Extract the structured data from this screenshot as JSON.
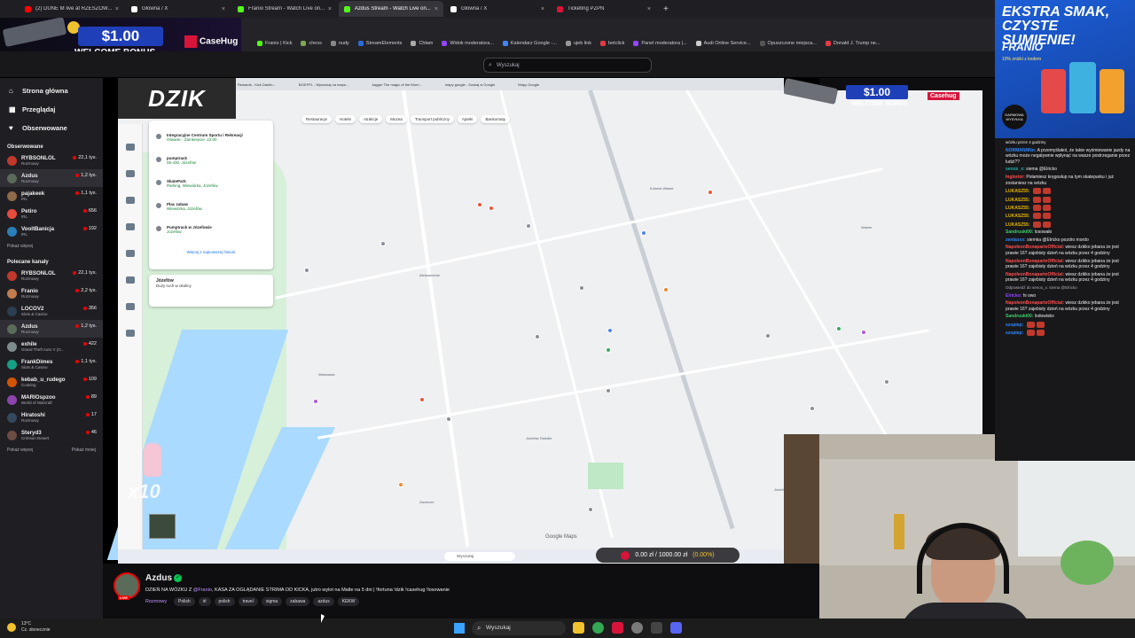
{
  "browser": {
    "tabs": [
      {
        "label": "(2) DUNE M live at RZESZOW...",
        "color": "#ff0000",
        "active": false
      },
      {
        "label": "Główna / X",
        "color": "#ffffff",
        "active": false
      },
      {
        "label": "Franio Stream - Watch Live on...",
        "color": "#53fc18",
        "active": false
      },
      {
        "label": "Azdus Stream - Watch Live on...",
        "color": "#53fc18",
        "active": true
      },
      {
        "label": "Główna / X",
        "color": "#ffffff",
        "active": false
      },
      {
        "label": "Ticketing PZPN",
        "color": "#d8143a",
        "active": false
      }
    ],
    "new_tab": "+",
    "bookmarks": [
      {
        "label": "Franio | Kick",
        "color": "#53fc18"
      },
      {
        "label": "chess",
        "color": "#7fa650"
      },
      {
        "label": "nudy",
        "color": "#888888"
      },
      {
        "label": "StreamElements",
        "color": "#2a6bd8"
      },
      {
        "label": "Chłam",
        "color": "#aaaaaa"
      },
      {
        "label": "Widok moderatora...",
        "color": "#9146ff"
      },
      {
        "label": "Kalendarz Google -...",
        "color": "#4285f4"
      },
      {
        "label": "ujeb link",
        "color": "#999999"
      },
      {
        "label": "betclick",
        "color": "#e63946"
      },
      {
        "label": "Panel moderatora |...",
        "color": "#9146ff"
      },
      {
        "label": "Audi Online Service...",
        "color": "#cccccc"
      },
      {
        "label": "Opuszczone miejsca...",
        "color": "#555555"
      },
      {
        "label": "Donald J. Trump ne...",
        "color": "#e63946"
      }
    ]
  },
  "ads": {
    "top_left": {
      "amount": "$1.00",
      "text": "WELCOME BONUS",
      "brand": "CaseHug"
    },
    "overlay": {
      "amount": "$1.00",
      "text": "WELCOME BONUS",
      "brand": "Casehug"
    },
    "right": {
      "headline": "EKSTRA SMAK, CZYSTE SUMIENIE!",
      "brand": "FRANIO",
      "sub": "10% zniżki z kodem",
      "badge": "DARMOWA WYSYŁKA"
    }
  },
  "twitch": {
    "search_placeholder": "Wyszukaj",
    "nav": [
      {
        "label": "Strona główna",
        "icon": "home-icon"
      },
      {
        "label": "Przeglądaj",
        "icon": "browse-icon"
      },
      {
        "label": "Obserwowane",
        "icon": "heart-icon"
      }
    ],
    "followed_heading": "Obserwowane",
    "followed": [
      {
        "name": "RYBSONLOL",
        "category": "Rozmowy",
        "viewers": "22,1 tys.",
        "color": "#c0392b"
      },
      {
        "name": "Azdus",
        "category": "Rozmowy",
        "viewers": "1,2 tys.",
        "color": "#5b6b5a",
        "selected": true
      },
      {
        "name": "pajakeek",
        "category": "IRL",
        "viewers": "1,1 tys.",
        "color": "#8e6b4a"
      },
      {
        "name": "Petiro",
        "category": "IRL",
        "viewers": "656",
        "color": "#e74c3c"
      },
      {
        "name": "VooltBanicja",
        "category": "IRL",
        "viewers": "192",
        "color": "#2980b9"
      }
    ],
    "show_more": "Pokaż więcej",
    "recommended_heading": "Polecane kanały",
    "recommended": [
      {
        "name": "RYBSONLOL",
        "category": "Rozmowy",
        "viewers": "22,1 tys.",
        "color": "#c0392b"
      },
      {
        "name": "Franio",
        "category": "Rozmowy",
        "viewers": "2,2 tys.",
        "color": "#c27c4e"
      },
      {
        "name": "LOCOV2",
        "category": "Slots & Casino",
        "viewers": "356",
        "color": "#2c3e50"
      },
      {
        "name": "Azdus",
        "category": "Rozmowy",
        "viewers": "1,2 tys.",
        "color": "#5b6b5a",
        "selected": true
      },
      {
        "name": "exhile",
        "category": "Grand Theft Auto V (G...",
        "viewers": "422",
        "color": "#7f8c8d"
      },
      {
        "name": "FrankDimes",
        "category": "Slots & Casino",
        "viewers": "1,1 tys.",
        "color": "#16a085"
      },
      {
        "name": "kebab_u_rudego",
        "category": "Cooking",
        "viewers": "109",
        "color": "#d35400"
      },
      {
        "name": "MARIOspzoo",
        "category": "World of Warcraft",
        "viewers": "89",
        "color": "#8e44ad"
      },
      {
        "name": "Hiratoshi",
        "category": "Rozmowy",
        "viewers": "17",
        "color": "#34495e"
      },
      {
        "name": "Steryd3",
        "category": "Crimson Desert",
        "viewers": "46",
        "color": "#6d4c41"
      }
    ],
    "show_more_2": "Pokaż więcej",
    "show_less": "Pokaż mniej"
  },
  "stream": {
    "overlay_logo": "DZIK",
    "multiplier": "x10",
    "donation": {
      "current": "0.00 zł",
      "goal": "1000.00 zł",
      "percent": "(0.00%)",
      "text": "0.00 zł / 1000.00 zł",
      "pct_value": 0
    },
    "map": {
      "tabs": [
        "Rewards - Kick Dashb...",
        "BODFPL - Wyszukaj na maps...",
        "Jagger The magic of the Morri...",
        "mapy google - Szukaj w Google",
        "Mapy Google"
      ],
      "filters": [
        "Restauracje",
        "Hotele",
        "Atrakcje",
        "Muzea",
        "Transport publiczny",
        "Apteki",
        "Bankomaty"
      ],
      "results": [
        {
          "title": "Integracyjne Centrum Sportu i Rekreacji",
          "sub": "Otwarte · Zamknięcie: 22:00"
        },
        {
          "title": "pumptrack",
          "sub": "05-430, Józefów"
        },
        {
          "title": "SkatePark",
          "sub": "Parking, Wiewiórka, Józefów"
        },
        {
          "title": "Plac zabaw",
          "sub": "Wiewiórka, Józefów"
        },
        {
          "title": "Pumptrack w Józefowie",
          "sub": "Józefów"
        }
      ],
      "more_results": "Więcej z najnowszej historii",
      "card_title": "Józefów",
      "card_sub": "Duży ruch w okolicy",
      "labels": [
        "Józefów",
        "Wawer",
        "Kolonia Wawer",
        "Aleksandrów",
        "Józefów Osiedle",
        "Zarzecze",
        "Warszawa"
      ],
      "brand": "Google Maps",
      "win_search": "Wyszukaj"
    },
    "info": {
      "streamer": "Azdus",
      "title_pre": "DZIEŃ NA WÓZKU Z ",
      "title_mention": "@Franio",
      "title_post": ", KASA ZA OGLĄDANIE STRIMA OD KICKA, jutro wylot na Malte na 5  dni | !fortuna !dzik !casehug !losowanie",
      "category": "Rozmowy",
      "tags": [
        "Polish",
        "irl",
        "polish",
        "travel",
        "sigma",
        "zabawa",
        "azdus",
        "KEKW"
      ],
      "live_badge": "LIVE"
    }
  },
  "chat": {
    "messages": [
      {
        "user": "",
        "color": "#efeff1",
        "text": "wózku przez 4 godziny"
      },
      {
        "user": "NORMANNNn:",
        "color": "#2e8bff",
        "text": "A przemyślałeś, że takie wyśmiewanie jazdy na wózku może negatywnie wpłynąć na wasze postrzeganie przez ludzi??"
      },
      {
        "user": "senox_x:",
        "color": "#1eb2a6",
        "text": "siema @Elricko"
      },
      {
        "user": "Inglorior:",
        "color": "#ff4f4f",
        "text": "Połamiesz kręgosłup na tym skateparku i już zostaniesz na wózku"
      },
      {
        "user": "LUKASZ55:",
        "color": "#e4b400",
        "text": ""
      },
      {
        "user": "LUKASZ55:",
        "color": "#e4b400",
        "text": ""
      },
      {
        "user": "LUKASZ55:",
        "color": "#e4b400",
        "text": ""
      },
      {
        "user": "LUKASZ55:",
        "color": "#e4b400",
        "text": ""
      },
      {
        "user": "LUKASZ55:",
        "color": "#e4b400",
        "text": ""
      },
      {
        "user": "Sandruski00:",
        "color": "#3cd36d",
        "text": "losowało"
      },
      {
        "user": "zentaxxx:",
        "color": "#2e8bff",
        "text": "siemka @Elricko pozdro mordo"
      },
      {
        "user": "NapoleonBonaparteOfficial:",
        "color": "#ff4f4f",
        "text": "wiesz dzikko jebana że jest prawie 16? zajebisty dzień na wózku przez 4 godziny"
      },
      {
        "user": "NapoleonBonaparteOfficial:",
        "color": "#ff4f4f",
        "text": "wiesz dzikko jebana że jest prawie 16? zajebisty dzień na wózku przez 4 godziny"
      },
      {
        "user": "NapoleonBonaparteOfficial:",
        "color": "#ff4f4f",
        "text": "wiesz dzikko jebana że jest prawie 16? zajebisty dzień na wózku przez 4 godziny"
      },
      {
        "user": "",
        "color": "#adadb8",
        "text": "Odpowiedź do senox_x: siema @Elricko"
      },
      {
        "user": "Elricko:",
        "color": "#9146ff",
        "text": "hi owo"
      },
      {
        "user": "NapoleonBonaparteOfficial:",
        "color": "#ff4f4f",
        "text": "wiesz dzikko jebana że jest prawie 16? zajebisty dzień na wózku przez 4 godziny"
      },
      {
        "user": "Sandruski00:",
        "color": "#3cd36d",
        "text": "lodowisko"
      },
      {
        "user": "szopiep:",
        "color": "#2e8bff",
        "text": ""
      },
      {
        "user": "szopiep:",
        "color": "#2e8bff",
        "text": ""
      }
    ]
  },
  "taskbar": {
    "temp": "13°C",
    "weather": "Cz. słonecznie",
    "search": "Wyszukaj"
  }
}
